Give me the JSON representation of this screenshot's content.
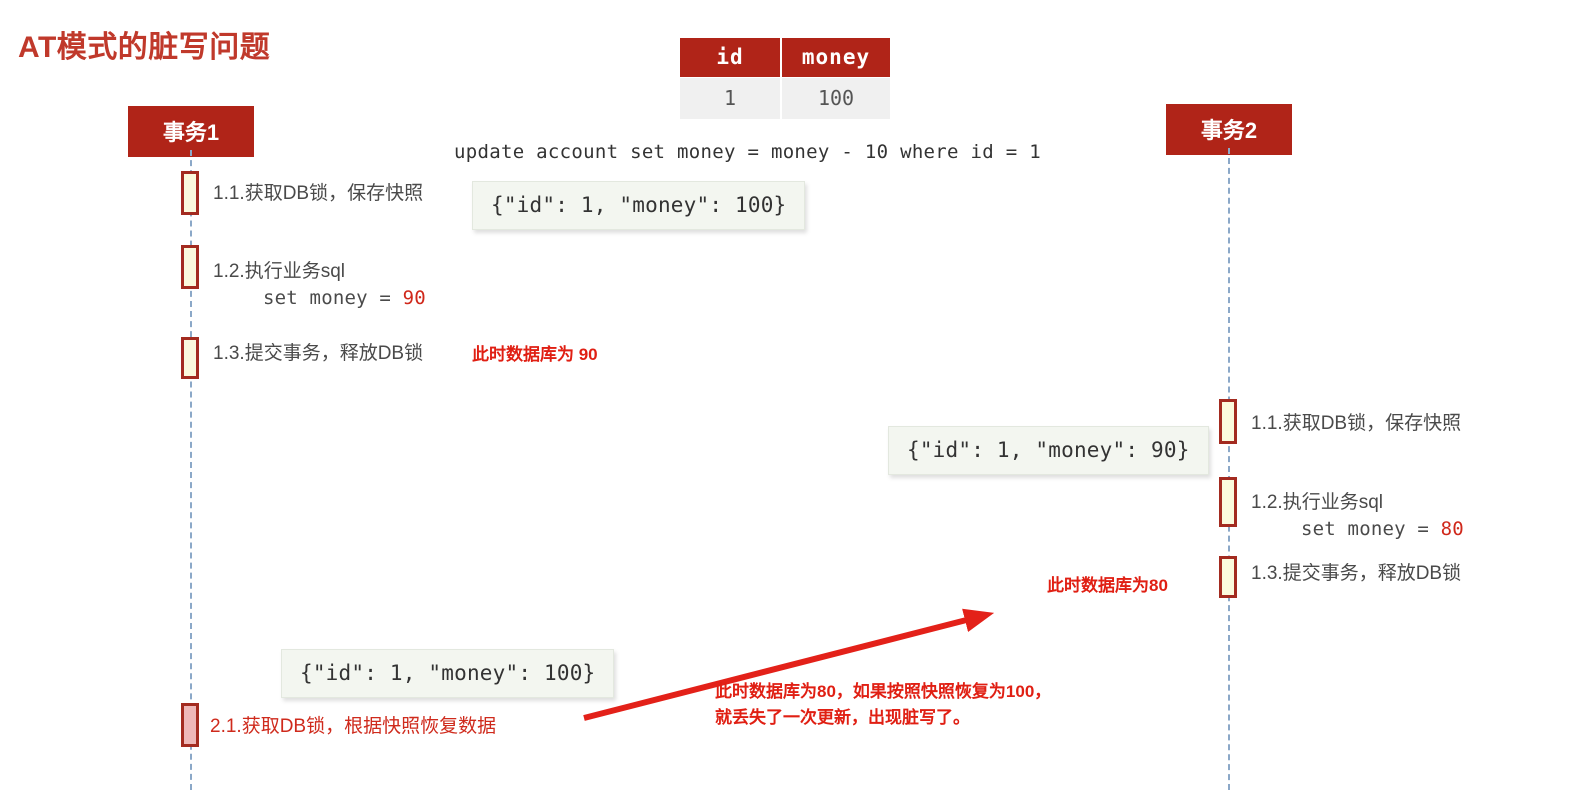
{
  "title": "AT模式的脏写问题",
  "colors": {
    "brand_red": "#b02418",
    "accent_red": "#d0281b",
    "annotation_red": "#e01f13",
    "activation_fill": "#fbfadd",
    "activation_border": "#a32b20",
    "dirty_fill": "#eeb8b8",
    "lifeline": "#8ba8c8",
    "snapshot_bg": "#f3f6f0",
    "text_gray": "#4a4a4a"
  },
  "table": {
    "headers": [
      "id",
      "money"
    ],
    "rows": [
      [
        "1",
        "100"
      ]
    ]
  },
  "sql": "update account set money = money - 10 where id = 1",
  "actors": {
    "left": "事务1",
    "right": "事务2"
  },
  "left_steps": [
    {
      "label": "1.1.获取DB锁，保存快照",
      "snapshot": "{\"id\": 1, \"money\": 100}"
    },
    {
      "label": "1.2.执行业务sql",
      "sub_prefix": "set money = ",
      "sub_value": "90"
    },
    {
      "label": "1.3.提交事务，释放DB锁",
      "annotation": "此时数据库为 90"
    },
    {
      "label": "2.1.获取DB锁，根据快照恢复数据",
      "snapshot": "{\"id\": 1, \"money\": 100}"
    }
  ],
  "right_steps": [
    {
      "label": "1.1.获取DB锁，保存快照",
      "snapshot": "{\"id\": 1, \"money\": 90}"
    },
    {
      "label": "1.2.执行业务sql",
      "sub_prefix": "set money = ",
      "sub_value": "80"
    },
    {
      "label": "1.3.提交事务，释放DB锁",
      "annotation": "此时数据库为80"
    }
  ],
  "conclusion": {
    "line1": "此时数据库为80，如果按照快照恢复为100，",
    "line2": "就丢失了一次更新，出现脏写了。"
  }
}
